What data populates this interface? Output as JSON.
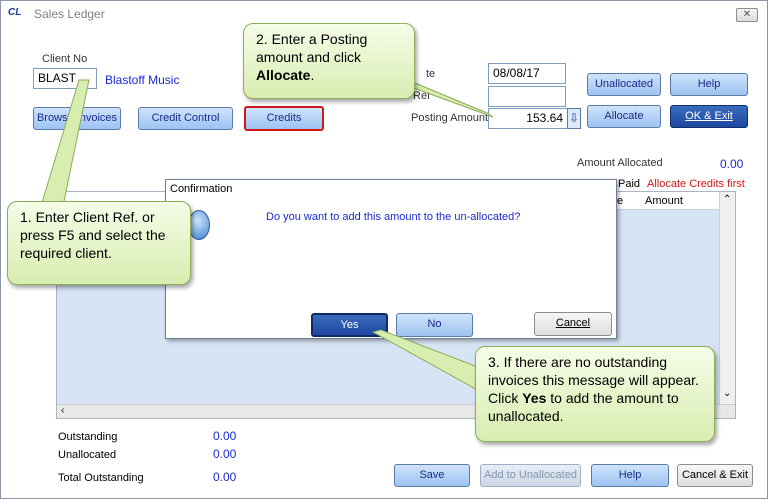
{
  "window": {
    "app_logo": "CL",
    "title": "Sales Ledger",
    "close_glyph": "✕"
  },
  "client": {
    "label": "Client No",
    "value": "BLAST",
    "name": "Blastoff Music"
  },
  "buttons": {
    "browse_invoices": "Browse Invoices",
    "credit_control": "Credit Control",
    "credits": "Credits",
    "unallocated": "Unallocated",
    "help_top": "Help",
    "allocate": "Allocate",
    "ok_exit": "OK & Exit",
    "save": "Save",
    "add_to_unallocated": "Add to Unallocated",
    "help_bottom": "Help",
    "cancel_exit": "Cancel & Exit"
  },
  "header_fields": {
    "date_label": "te",
    "date_value": "08/08/17",
    "ref_label": "Ref",
    "ref_value": "",
    "posting_label": "Posting Amount",
    "posting_value": "153.64"
  },
  "allocated": {
    "label": "Amount Allocated",
    "value": "0.00"
  },
  "grid": {
    "paid_header": "Paid",
    "allocate_credits_first": "Allocate Credits first",
    "col_e": "e",
    "amount_header": "Amount"
  },
  "dialog": {
    "title": "Confirmation",
    "message": "Do you want to add this amount to the un-allocated?",
    "yes": "Yes",
    "no": "No",
    "cancel": "Cancel"
  },
  "totals": [
    {
      "label": "Outstanding",
      "value": "0.00"
    },
    {
      "label": "Unallocated",
      "value": "0.00"
    },
    {
      "label": "Total Outstanding",
      "value": "0.00"
    }
  ],
  "callouts": {
    "step1": "1. Enter Client Ref. or press F5 and select the required client.",
    "step2_text": "2. Enter a Posting amount and click",
    "step2_bold": "Allocate",
    "step3_pre": "3. If there are no outstanding invoices this message will appear. Click",
    "step3_bold": "Yes",
    "step3_post": "to add the amount to unallocated."
  },
  "colors": {
    "accent_red": "#d01818",
    "link_blue": "#1a2ad0",
    "callout_green": "#d8edb0"
  }
}
